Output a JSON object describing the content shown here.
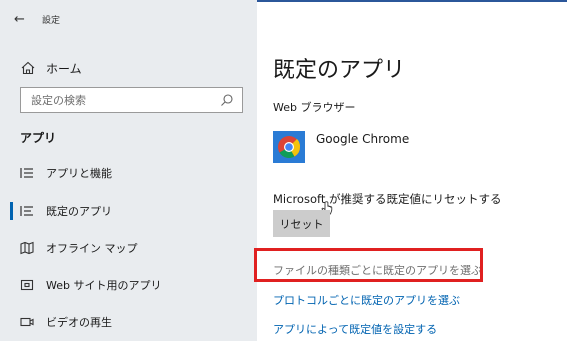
{
  "window": {
    "title": "設定",
    "back_glyph": "←"
  },
  "sidebar": {
    "home_label": "ホーム",
    "search_placeholder": "設定の検索",
    "section_title": "アプリ",
    "items": [
      {
        "label": "アプリと機能",
        "icon": "list-icon",
        "selected": false
      },
      {
        "label": "既定のアプリ",
        "icon": "default-apps-icon",
        "selected": true
      },
      {
        "label": "オフライン マップ",
        "icon": "map-icon",
        "selected": false
      },
      {
        "label": "Web サイト用のアプリ",
        "icon": "web-app-icon",
        "selected": false
      },
      {
        "label": "ビデオの再生",
        "icon": "video-icon",
        "selected": false
      }
    ]
  },
  "main": {
    "title": "既定のアプリ",
    "web_browser_label": "Web ブラウザー",
    "browser_name": "Google Chrome",
    "reset_text": "Microsoft が推奨する既定値にリセットする",
    "reset_button": "リセット",
    "links": [
      "ファイルの種類ごとに既定のアプリを選ぶ",
      "プロトコルごとに既定のアプリを選ぶ",
      "アプリによって既定値を設定する"
    ]
  },
  "colors": {
    "sidebar_bg": "#e9ecef",
    "accent": "#0063b1",
    "highlight": "#e02020",
    "button_bg": "#cccccc"
  }
}
